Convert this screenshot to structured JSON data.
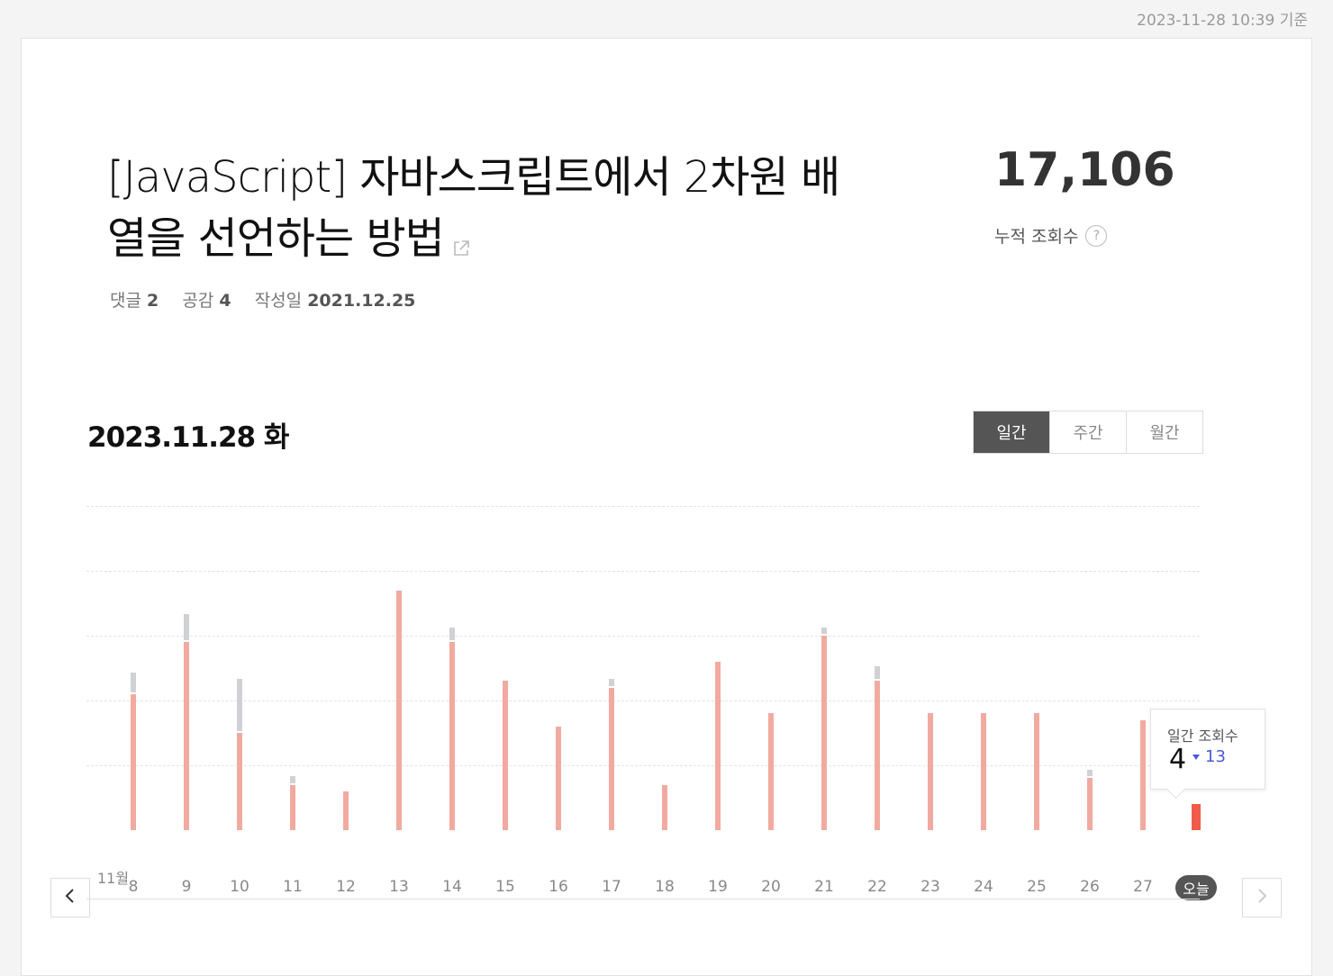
{
  "timestamp": "2023-11-28 10:39 기준",
  "post": {
    "title": "[JavaScript] 자바스크립트에서 2차원 배열을 선언하는 방법",
    "comments_label": "댓글",
    "comments_count": "2",
    "likes_label": "공감",
    "likes_count": "4",
    "created_label": "작성일",
    "created_date": "2021.12.25"
  },
  "total": {
    "count": "17,106",
    "label": "누적 조회수"
  },
  "selected_date": "2023.11.28 화",
  "period_tabs": [
    {
      "label": "일간",
      "active": true
    },
    {
      "label": "주간",
      "active": false
    },
    {
      "label": "월간",
      "active": false
    }
  ],
  "tooltip": {
    "label": "일간 조회수",
    "value": "4",
    "diff": "13"
  },
  "month_label": "11월",
  "today_label": "오늘",
  "colors": {
    "bar": "#f1aaa0",
    "bar_extra": "#cfd1d4",
    "today_bar": "#ef5a4a",
    "diff_down": "#4a5ad8"
  },
  "chart_data": {
    "type": "bar",
    "categories": [
      "8",
      "9",
      "10",
      "11",
      "12",
      "13",
      "14",
      "15",
      "16",
      "17",
      "18",
      "19",
      "20",
      "21",
      "22",
      "23",
      "24",
      "25",
      "26",
      "27",
      "오늘"
    ],
    "ylim": [
      0,
      55
    ],
    "series": [
      {
        "values": [
          21,
          29,
          15,
          7,
          6,
          37,
          29,
          23,
          16,
          22,
          7,
          26,
          18,
          30,
          23,
          18,
          18,
          18,
          8,
          17,
          4
        ]
      },
      {
        "values": [
          3,
          4,
          8,
          1,
          0,
          0,
          2,
          0,
          0,
          1,
          0,
          0,
          0,
          1,
          2,
          0,
          0,
          0,
          1,
          0,
          0
        ]
      }
    ]
  }
}
